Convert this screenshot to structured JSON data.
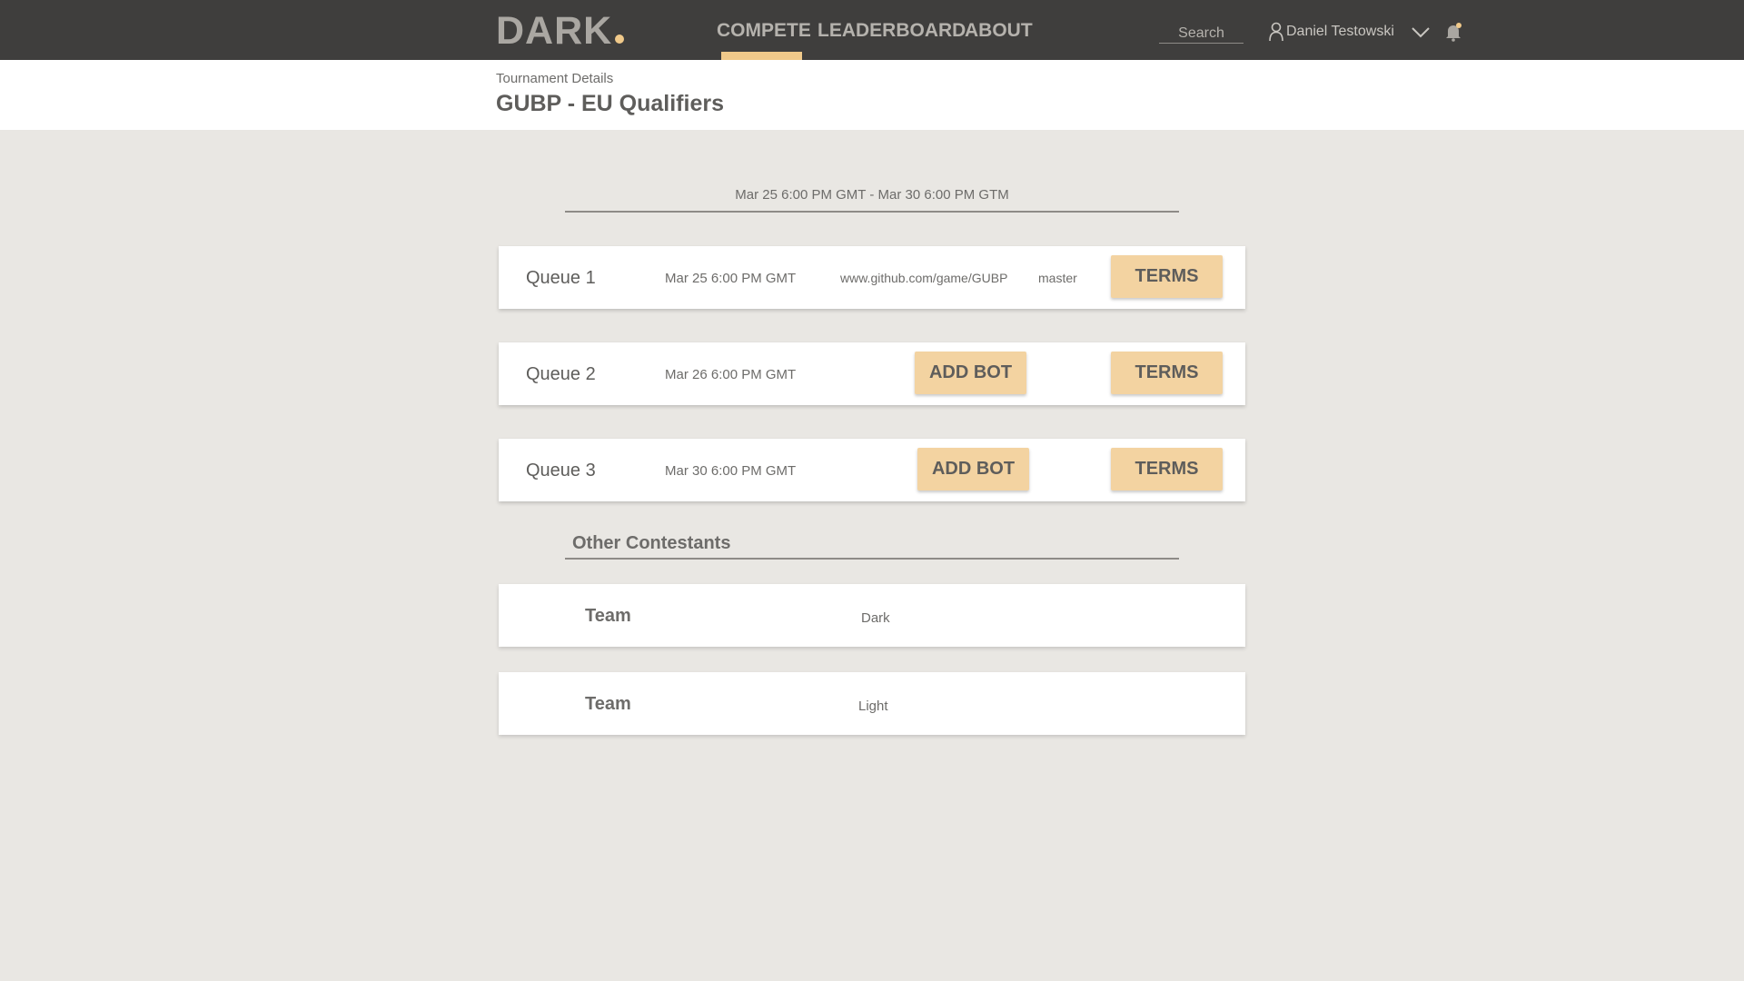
{
  "app": {
    "logo": "DARK",
    "nav": [
      {
        "label": "COMPETE"
      },
      {
        "label": "LEADERBOARD"
      },
      {
        "label": "ABOUT"
      }
    ],
    "search_placeholder": "Search",
    "user_name": "Daniel Testowski",
    "active_nav": "COMPETE"
  },
  "header": {
    "breadcrumb": "Tournament Details",
    "title": "GUBP - EU Qualifiers"
  },
  "tournament": {
    "date_range": "Mar 25 6:00 PM GMT - Mar 30 6:00 PM GTM",
    "queues": [
      {
        "name": "Queue 1",
        "date": "Mar 25 6:00 PM GMT",
        "repo": "www.github.com/game/GUBP",
        "branch": "master",
        "terms_label": "TERMS"
      },
      {
        "name": "Queue 2",
        "date": "Mar 26 6:00 PM GMT",
        "add_bot_label": "ADD BOT",
        "terms_label": "TERMS"
      },
      {
        "name": "Queue 3",
        "date": "Mar 30 6:00 PM GMT",
        "add_bot_label": "ADD BOT",
        "terms_label": "TERMS"
      }
    ]
  },
  "contestants": {
    "title": "Other Contestants",
    "teams": [
      {
        "label": "Team",
        "name": "Dark"
      },
      {
        "label": "Team",
        "name": "Light"
      }
    ]
  },
  "colors": {
    "topbar": "#3f3e3d",
    "accent": "#f0c98a",
    "button": "#f3d3a1",
    "background": "#e9e7e3"
  },
  "icons": {
    "user": "user-icon",
    "dropdown": "chevron-down-icon",
    "notifications": "bell-icon"
  }
}
